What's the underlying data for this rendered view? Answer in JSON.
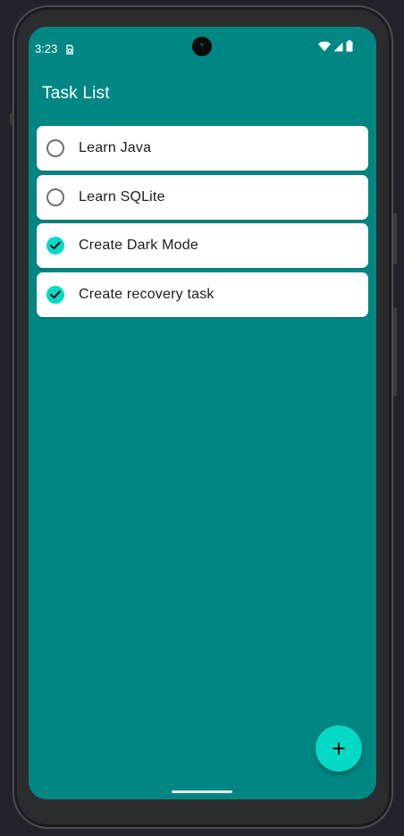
{
  "status_bar": {
    "time": "3:23",
    "icons": [
      "sim-card-icon",
      "wifi-icon",
      "cellular-signal-icon",
      "battery-icon"
    ]
  },
  "app_bar": {
    "title": "Task List"
  },
  "tasks": [
    {
      "label": "Learn Java",
      "checked": false
    },
    {
      "label": "Learn SQLite",
      "checked": false
    },
    {
      "label": "Create Dark Mode",
      "checked": true
    },
    {
      "label": "Create recovery task",
      "checked": true
    }
  ],
  "fab": {
    "icon": "plus-icon"
  },
  "colors": {
    "background": "#008784",
    "card": "#ffffff",
    "accent": "#03dac5",
    "checkmark": "#000000",
    "text": "#1c1c1c"
  }
}
